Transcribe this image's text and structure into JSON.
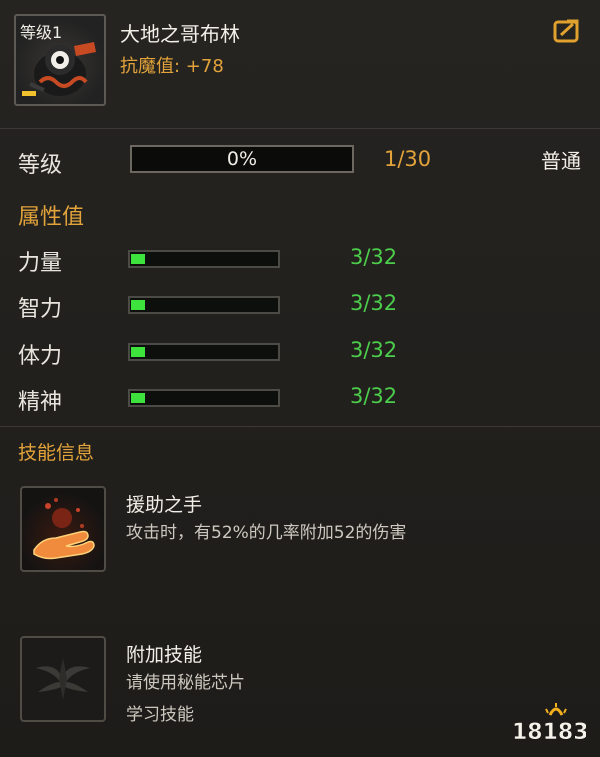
{
  "header": {
    "level_badge": "等级1",
    "monster_name": "大地之哥布林",
    "resistance": "抗魔值: +78"
  },
  "level": {
    "label": "等级",
    "progress_text": "0%",
    "progress_fraction": 0,
    "count": "1/30",
    "quality": "普通"
  },
  "attributes": {
    "title": "属性值",
    "items": [
      {
        "label": "力量",
        "value": "3/32",
        "fraction": 0.094
      },
      {
        "label": "智力",
        "value": "3/32",
        "fraction": 0.094
      },
      {
        "label": "体力",
        "value": "3/32",
        "fraction": 0.094
      },
      {
        "label": "精神",
        "value": "3/32",
        "fraction": 0.094
      }
    ]
  },
  "skills": {
    "title": "技能信息",
    "primary": {
      "name": "援助之手",
      "description": "攻击时，有52%的几率附加52的伤害"
    },
    "extra": {
      "name": "附加技能",
      "line1": "请使用秘能芯片",
      "line2": "学习技能"
    }
  },
  "watermark": "18183",
  "colors": {
    "accent": "#e2a33a",
    "positive": "#4ccd4c",
    "fill": "#3de23d",
    "panel": "#211f1c"
  },
  "icons": {
    "share": "share-out-icon",
    "skill_primary": "helping-hand-icon",
    "skill_extra": "sealed-skill-icon"
  }
}
